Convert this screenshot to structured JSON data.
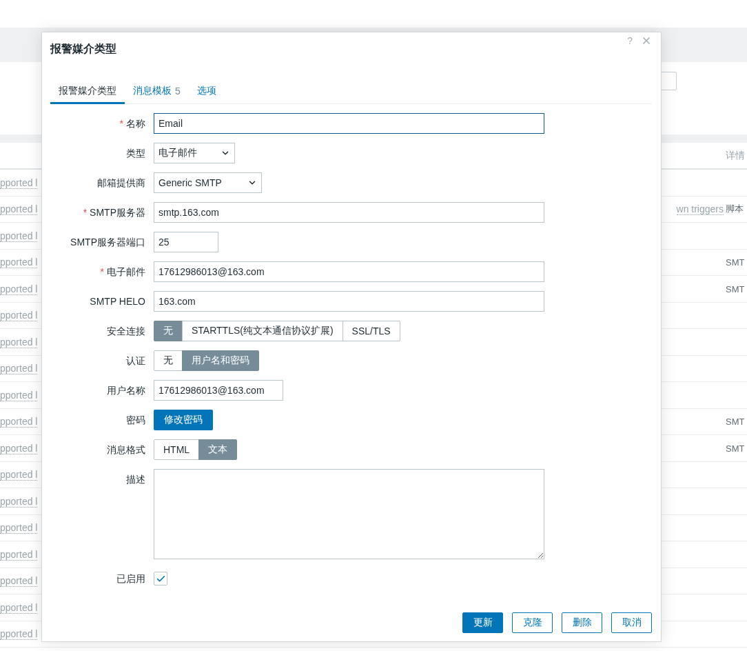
{
  "background": {
    "details_header": "详情",
    "rows": [
      {
        "column_1": "pported l"
      },
      {
        "column_1": "pported l",
        "column_2": "wn triggers",
        "column_3": "脚本"
      },
      {
        "column_1": "pported l"
      },
      {
        "column_1": "pported l",
        "column_3": "SMT"
      },
      {
        "column_1": "pported l",
        "column_3": "SMT"
      },
      {
        "column_1": "pported l"
      },
      {
        "column_1": "pported l"
      },
      {
        "column_1": "pported l"
      },
      {
        "column_1": "pported l"
      },
      {
        "column_1": "pported l",
        "column_3": "SMT"
      },
      {
        "column_1": "pported l",
        "column_3": "SMT"
      },
      {
        "column_1": "pported l"
      },
      {
        "column_1": "pported l"
      },
      {
        "column_1": "pported l"
      },
      {
        "column_1": "pported l"
      },
      {
        "column_1": "pported l"
      },
      {
        "column_1": "pported l"
      },
      {
        "column_1": "pported l"
      }
    ]
  },
  "dialog": {
    "title": "报警媒介类型",
    "help": "?",
    "tabs": [
      {
        "label": "报警媒介类型",
        "selected": true
      },
      {
        "label": "消息模板",
        "count": "5",
        "selected": false
      },
      {
        "label": "选项",
        "selected": false
      }
    ],
    "fields": [
      {
        "kind": "text",
        "required_mark": "*",
        "label": "名称",
        "value": "Email",
        "focused": true
      },
      {
        "kind": "select",
        "label": "类型",
        "value": "电子邮件"
      },
      {
        "kind": "select",
        "label": "邮箱提供商",
        "value": "Generic SMTP"
      },
      {
        "kind": "text",
        "required_mark": "*",
        "label": "SMTP服务器",
        "value": "smtp.163.com",
        "focused": false
      },
      {
        "kind": "text",
        "label": "SMTP服务器端口",
        "value": "25",
        "focused": false
      },
      {
        "kind": "text",
        "required_mark": "*",
        "label": "电子邮件",
        "value": "17612986013@163.com",
        "focused": false
      },
      {
        "kind": "text",
        "label": "SMTP HELO",
        "value": "163.com",
        "focused": false
      },
      {
        "kind": "segmented",
        "label": "安全连接",
        "options": [
          {
            "label": "无",
            "selected": true
          },
          {
            "label": "STARTTLS(纯文本通信协议扩展)",
            "selected": false
          },
          {
            "label": "SSL/TLS",
            "selected": false
          }
        ]
      },
      {
        "kind": "segmented",
        "label": "认证",
        "options": [
          {
            "label": "无",
            "selected": false
          },
          {
            "label": "用户名和密码",
            "selected": true
          }
        ]
      },
      {
        "kind": "text",
        "label": "用户名称",
        "value": "17612986013@163.com",
        "focused": false
      },
      {
        "kind": "button",
        "label": "密码",
        "value": "修改密码"
      },
      {
        "kind": "segmented",
        "label": "消息格式",
        "options": [
          {
            "label": "HTML",
            "selected": false
          },
          {
            "label": "文本",
            "selected": true
          }
        ]
      },
      {
        "kind": "textarea",
        "label": "描述"
      },
      {
        "kind": "checkbox",
        "label": "已启用",
        "checked": true
      }
    ],
    "buttons": [
      {
        "label": "更新",
        "primary": true
      },
      {
        "label": "克隆",
        "primary": false
      },
      {
        "label": "删除",
        "primary": false
      },
      {
        "label": "取消",
        "primary": false
      }
    ]
  }
}
